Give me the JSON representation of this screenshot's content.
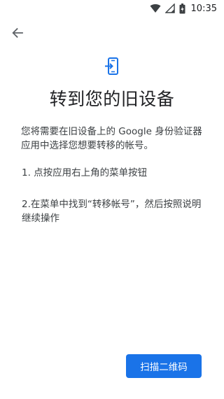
{
  "status_bar": {
    "time": "10:35",
    "icons": [
      "wifi-icon",
      "signal-icon",
      "battery-icon"
    ]
  },
  "nav": {
    "back_icon": "arrow-back-icon"
  },
  "header_icon": "phone-transfer-icon",
  "title": "转到您的旧设备",
  "description": "您将需要在旧设备上的 Google 身份验证器应用中选择您想要转移的帐号。",
  "steps": [
    "1. 点按应用右上角的菜单按钮",
    "2.在菜单中找到“转移帐号”，然后按照说明继续操作"
  ],
  "primary_button": {
    "label": "扫描二维码"
  },
  "colors": {
    "accent": "#1a73e8",
    "text_primary": "#202124",
    "text_secondary": "#3c4043",
    "background": "#ffffff"
  }
}
